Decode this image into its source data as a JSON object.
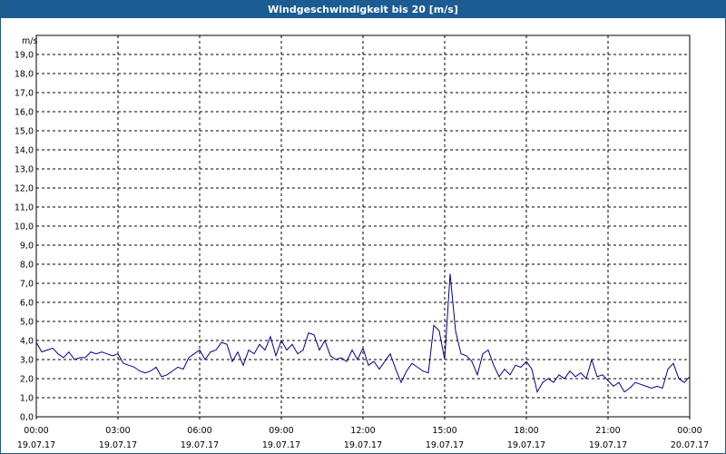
{
  "window": {
    "title": "Windgeschwindigkeit bis 20 [m/s]"
  },
  "colors": {
    "titlebar": "#1a5c93",
    "line": "#00008b",
    "grid": "#000000"
  },
  "chart_data": {
    "type": "line",
    "title": "Windgeschwindigkeit bis 20 [m/s]",
    "ylabel": "m/s",
    "ylim": [
      0,
      20
    ],
    "y_ticks": [
      "0,0",
      "1,0",
      "2,0",
      "3,0",
      "4,0",
      "5,0",
      "6,0",
      "7,0",
      "8,0",
      "9,0",
      "10,0",
      "11,0",
      "12,0",
      "13,0",
      "14,0",
      "15,0",
      "16,0",
      "17,0",
      "18,0",
      "19,0"
    ],
    "x_range_hours": [
      0,
      24
    ],
    "x_ticks": [
      {
        "time": "00:00",
        "date": "19.07.17"
      },
      {
        "time": "03:00",
        "date": "19.07.17"
      },
      {
        "time": "06:00",
        "date": "19.07.17"
      },
      {
        "time": "09:00",
        "date": "19.07.17"
      },
      {
        "time": "12:00",
        "date": "19.07.17"
      },
      {
        "time": "15:00",
        "date": "19.07.17"
      },
      {
        "time": "18:00",
        "date": "19.07.17"
      },
      {
        "time": "21:00",
        "date": "19.07.17"
      },
      {
        "time": "00:00",
        "date": "20.07.17"
      }
    ],
    "grid": true,
    "series": [
      {
        "x": [
          0,
          0.2,
          0.4,
          0.6,
          0.8,
          1.0,
          1.2,
          1.4,
          1.6,
          1.8,
          2.0,
          2.2,
          2.4,
          2.6,
          2.8,
          3.0,
          3.2,
          3.4,
          3.6,
          3.8,
          4.0,
          4.2,
          4.4,
          4.6,
          4.8,
          5.0,
          5.2,
          5.4,
          5.6,
          5.8,
          6.0,
          6.2,
          6.4,
          6.6,
          6.8,
          7.0,
          7.2,
          7.4,
          7.6,
          7.8,
          8.0,
          8.2,
          8.4,
          8.6,
          8.8,
          9.0,
          9.2,
          9.4,
          9.6,
          9.8,
          10.0,
          10.2,
          10.4,
          10.6,
          10.8,
          11.0,
          11.2,
          11.4,
          11.6,
          11.8,
          12.0,
          12.2,
          12.4,
          12.6,
          12.8,
          13.0,
          13.2,
          13.4,
          13.6,
          13.8,
          14.0,
          14.2,
          14.4,
          14.6,
          14.8,
          15.0,
          15.2,
          15.4,
          15.6,
          15.8,
          16.0,
          16.2,
          16.4,
          16.6,
          16.8,
          17.0,
          17.2,
          17.4,
          17.6,
          17.8,
          18.0,
          18.2,
          18.4,
          18.6,
          18.8,
          19.0,
          19.2,
          19.4,
          19.6,
          19.8,
          20.0,
          20.2,
          20.4,
          20.6,
          20.8,
          21.0,
          21.2,
          21.4,
          21.6,
          21.8,
          22.0,
          22.2,
          22.4,
          22.6,
          22.8,
          23.0,
          23.2,
          23.4,
          23.6,
          23.8,
          24.0
        ],
        "y": [
          3.9,
          3.4,
          3.5,
          3.6,
          3.3,
          3.1,
          3.4,
          3.0,
          3.1,
          3.1,
          3.4,
          3.3,
          3.4,
          3.3,
          3.2,
          3.3,
          2.8,
          2.7,
          2.6,
          2.4,
          2.3,
          2.4,
          2.6,
          2.1,
          2.2,
          2.4,
          2.6,
          2.5,
          3.1,
          3.3,
          3.5,
          3.0,
          3.4,
          3.5,
          3.9,
          3.8,
          2.9,
          3.4,
          2.7,
          3.5,
          3.3,
          3.8,
          3.5,
          4.2,
          3.2,
          4.0,
          3.5,
          3.8,
          3.3,
          3.5,
          4.4,
          4.3,
          3.5,
          4.0,
          3.2,
          3.0,
          3.1,
          2.9,
          3.5,
          3.0,
          3.6,
          2.7,
          2.9,
          2.5,
          2.9,
          3.3,
          2.5,
          1.8,
          2.4,
          2.8,
          2.6,
          2.4,
          2.3,
          4.8,
          4.5,
          3.0,
          7.5,
          4.5,
          3.3,
          3.2,
          2.9,
          2.2,
          3.3,
          3.5,
          2.7,
          2.1,
          2.5,
          2.2,
          2.7,
          2.6,
          2.9,
          2.5,
          1.3,
          1.8,
          2.0,
          1.8,
          2.2,
          2.0,
          2.4,
          2.1,
          2.3,
          2.0,
          3.0,
          2.1,
          2.2,
          1.9,
          1.6,
          1.8,
          1.3,
          1.5,
          1.8,
          1.7,
          1.6,
          1.5,
          1.6,
          1.5,
          2.5,
          2.8,
          2.0,
          1.8,
          2.1
        ]
      }
    ]
  }
}
